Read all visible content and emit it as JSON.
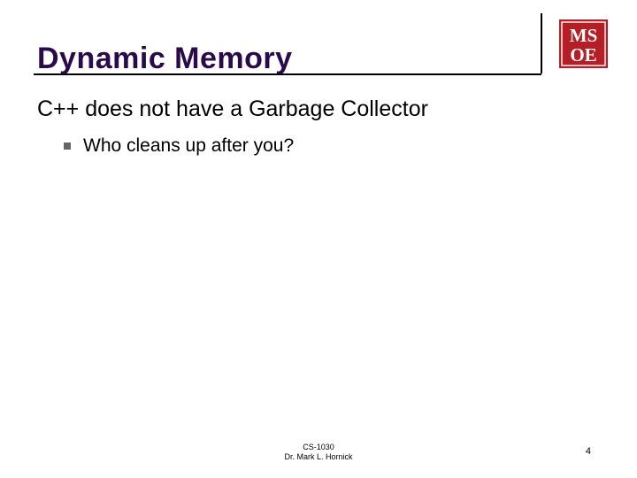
{
  "title": "Dynamic Memory",
  "logo": {
    "top": "MS",
    "bottom": "OE"
  },
  "body": {
    "level1": "C++ does not have a Garbage Collector",
    "level2": "Who cleans up after you?"
  },
  "footer": {
    "course": "CS-1030",
    "author": "Dr. Mark L. Hornick",
    "page": "4"
  },
  "colors": {
    "title": "#2a0a4a",
    "logo_bg": "#b41e24",
    "logo_fg": "#ffffff"
  }
}
